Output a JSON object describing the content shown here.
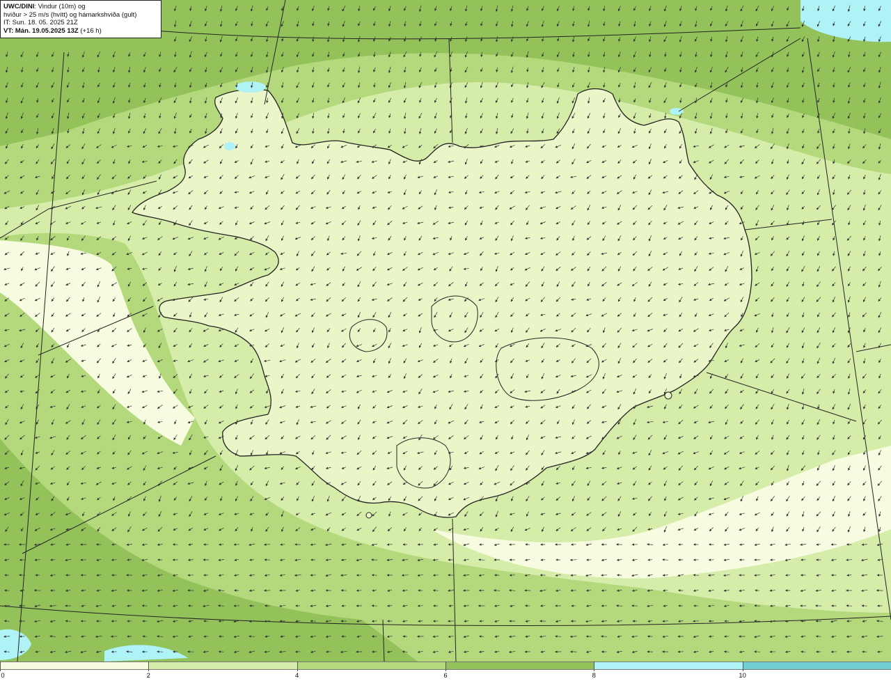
{
  "title_box": {
    "line1_bold": "UWC/DINI",
    "line1_rest": ": Vindur (10m) og",
    "line2": "hviður > 25 m/s (hvítt) og hámarkshviða (gult)",
    "line3": "IT: Sun. 18. 05. 2025 21Z",
    "line4_bold": "VT: Mán. 19.05.2025 13Z",
    "line4_rest": " (+16 h)"
  },
  "colors": {
    "bin_0_2": "#f7fbdf",
    "bin_2_4": "#d6edaa",
    "bin_4_6": "#b4d97c",
    "bin_6_8": "#93c25a",
    "bin_8_10": "#aff3f7",
    "bin_10_12": "#6fcfd4",
    "land": "#eaf6c8",
    "coastline": "#222222",
    "grid": "#222222",
    "arrow": "#333333"
  },
  "legend": {
    "unit": "m/s",
    "bins": [
      {
        "from": 0,
        "to": 2,
        "color": "#f7fbdf"
      },
      {
        "from": 2,
        "to": 4,
        "color": "#d6edaa"
      },
      {
        "from": 4,
        "to": 6,
        "color": "#b4d97c"
      },
      {
        "from": 6,
        "to": 8,
        "color": "#93c25a"
      },
      {
        "from": 8,
        "to": 10,
        "color": "#aff3f7"
      },
      {
        "from": 10,
        "to": 12,
        "color": "#6fcfd4"
      }
    ],
    "labels": [
      "0",
      "2",
      "4",
      "6",
      "8",
      "10"
    ]
  }
}
